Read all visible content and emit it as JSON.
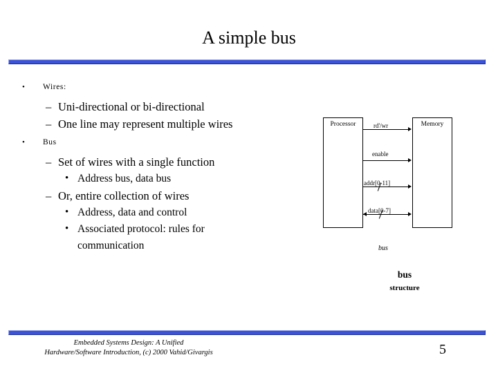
{
  "slide": {
    "title": "A simple bus",
    "page_number": "5",
    "footer_line1": "Embedded Systems Design: A Unified",
    "footer_line2": "Hardware/Software Introduction, (c) 2000 Vahid/Givargis",
    "accent_color": "#3b53d6"
  },
  "bullets": {
    "b1": "Wires:",
    "b1_s1": "Uni-directional or bi-directional",
    "b1_s2": "One line may represent multiple wires",
    "b2": "Bus",
    "b2_s1": "Set of wires with a single function",
    "b2_s1_1": "Address bus, data bus",
    "b2_s2": "Or, entire collection of wires",
    "b2_s2_1": "Address, data and control",
    "b2_s2_2": "Associated protocol: rules for",
    "b2_s2_2_cont": "communication"
  },
  "figure": {
    "processor": "Processor",
    "memory": "Memory",
    "signal_rdwr": "rd'/wr",
    "signal_enable": "enable",
    "signal_addr": "addr[0-11]",
    "signal_data": "data[0-7]",
    "bus_italic": "bus",
    "caption_bold": "bus",
    "caption_sub": "structure"
  }
}
